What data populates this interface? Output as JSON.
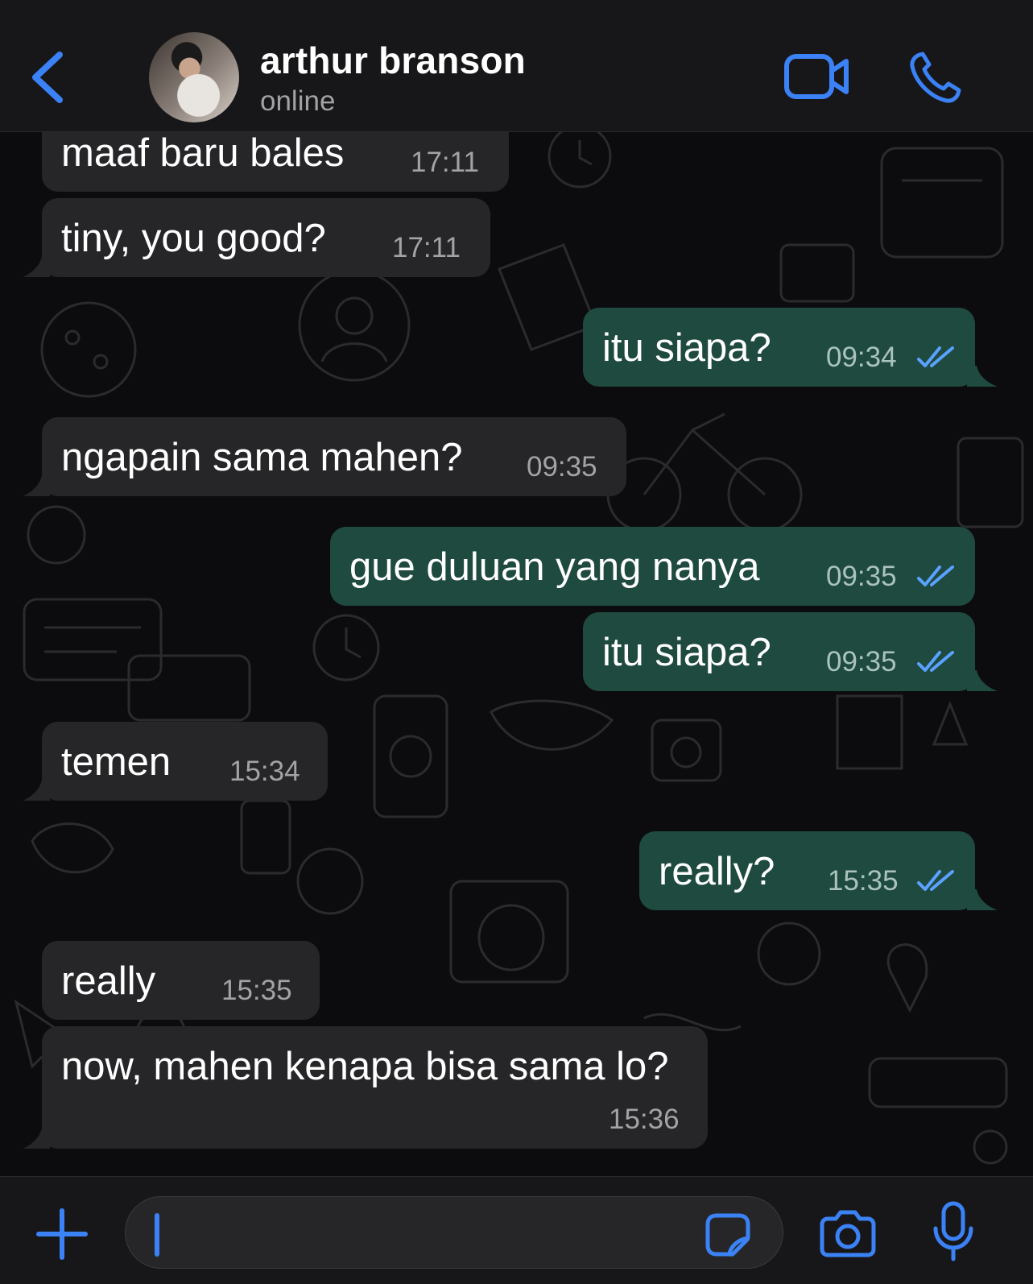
{
  "header": {
    "contact_name": "arthur branson",
    "status": "online",
    "icons": [
      "back-chevron-icon",
      "video-call-icon",
      "voice-call-icon"
    ]
  },
  "colors": {
    "accent": "#3b82f6",
    "incoming_bubble": "#262628",
    "outgoing_bubble": "#1f4a40"
  },
  "messages": [
    {
      "direction": "in",
      "text": "maaf baru bales",
      "time": "17:11"
    },
    {
      "direction": "in",
      "text": "tiny, you good?",
      "time": "17:11"
    },
    {
      "direction": "out",
      "text": "itu siapa?",
      "time": "09:34",
      "read": true
    },
    {
      "direction": "in",
      "text": "ngapain sama mahen?",
      "time": "09:35"
    },
    {
      "direction": "out",
      "text": "gue duluan yang nanya",
      "time": "09:35",
      "read": true
    },
    {
      "direction": "out",
      "text": "itu siapa?",
      "time": "09:35",
      "read": true
    },
    {
      "direction": "in",
      "text": "temen",
      "time": "15:34"
    },
    {
      "direction": "out",
      "text": "really?",
      "time": "15:35",
      "read": true
    },
    {
      "direction": "in",
      "text": "really",
      "time": "15:35"
    },
    {
      "direction": "in",
      "text": "now, mahen kenapa bisa sama lo?",
      "time": "15:36"
    }
  ],
  "composer": {
    "value": "",
    "icons": [
      "plus-icon",
      "sticker-icon",
      "camera-icon",
      "microphone-icon"
    ]
  }
}
